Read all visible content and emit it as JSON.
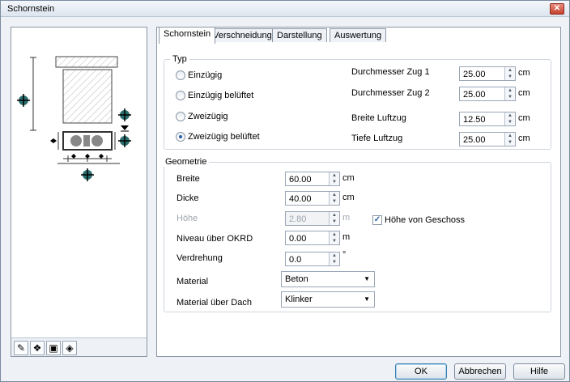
{
  "window": {
    "title": "Schornstein",
    "close_label": "✕"
  },
  "tabs": [
    {
      "label": "Schornstein"
    },
    {
      "label": "Verschneidung"
    },
    {
      "label": "Darstellung"
    },
    {
      "label": "Auswertung"
    }
  ],
  "typ": {
    "title": "Typ",
    "options": [
      {
        "label": "Einzügig",
        "checked": false
      },
      {
        "label": "Einzügig belüftet",
        "checked": false
      },
      {
        "label": "Zweizügig",
        "checked": false
      },
      {
        "label": "Zweizügig belüftet",
        "checked": true
      }
    ],
    "fields": [
      {
        "label": "Durchmesser Zug 1",
        "value": "25.00",
        "unit": "cm"
      },
      {
        "label": "Durchmesser Zug 2",
        "value": "25.00",
        "unit": "cm"
      },
      {
        "label": "Breite Luftzug",
        "value": "12.50",
        "unit": "cm"
      },
      {
        "label": "Tiefe Luftzug",
        "value": "25.00",
        "unit": "cm"
      }
    ]
  },
  "geometrie": {
    "title": "Geometrie",
    "fields": [
      {
        "label": "Breite",
        "value": "60.00",
        "unit": "cm"
      },
      {
        "label": "Dicke",
        "value": "40.00",
        "unit": "cm"
      },
      {
        "label": "Höhe",
        "value": "2.80",
        "unit": "m",
        "disabled": true
      },
      {
        "label": "Niveau über OKRD",
        "value": "0.00",
        "unit": "m"
      },
      {
        "label": "Verdrehung",
        "value": "0.0",
        "unit": "°"
      }
    ],
    "hoehe_von_geschoss": {
      "label": "Höhe von Geschoss",
      "checked": true
    },
    "material": {
      "label": "Material",
      "value": "Beton"
    },
    "material_dach": {
      "label": "Material über Dach",
      "value": "Klinker"
    }
  },
  "buttons": {
    "ok": "OK",
    "cancel": "Abbrechen",
    "help": "Hilfe"
  },
  "icons": [
    "edit-icon",
    "layers-icon",
    "image-icon",
    "eraser-icon"
  ]
}
